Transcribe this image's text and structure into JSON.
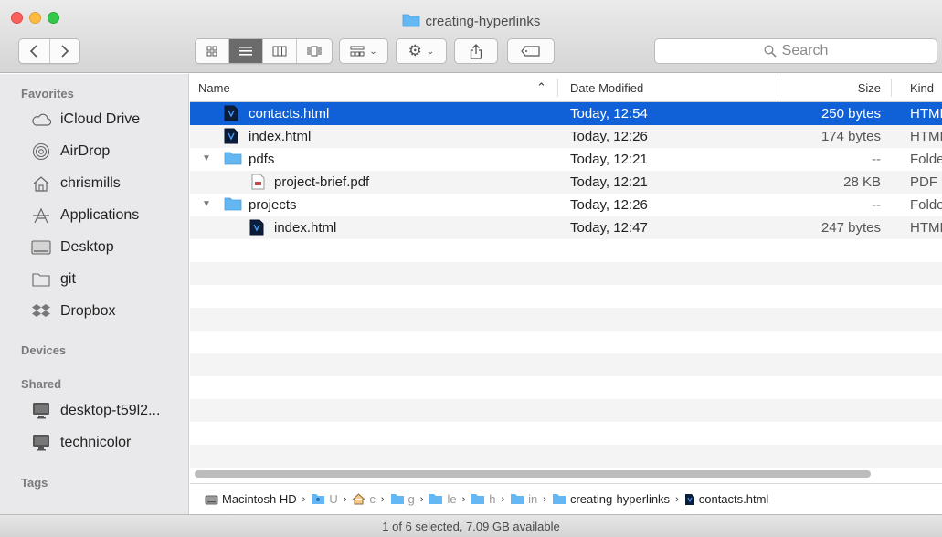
{
  "window": {
    "title": "creating-hyperlinks"
  },
  "toolbar": {
    "view_icon": "▦ ⌄",
    "action_icon": "⚙ ⌄",
    "share_icon": "⬆",
    "tag_icon": "▭"
  },
  "search": {
    "placeholder": "Search",
    "icon": "🔍"
  },
  "sidebar": {
    "favorites_header": "Favorites",
    "favorites": [
      {
        "label": "iCloud Drive",
        "icon": "cloud-icon"
      },
      {
        "label": "AirDrop",
        "icon": "airdrop-icon"
      },
      {
        "label": "chrismills",
        "icon": "home-icon"
      },
      {
        "label": "Applications",
        "icon": "applications-icon"
      },
      {
        "label": "Desktop",
        "icon": "desktop-icon"
      },
      {
        "label": "git",
        "icon": "folder-icon"
      },
      {
        "label": "Dropbox",
        "icon": "dropbox-icon"
      }
    ],
    "devices_header": "Devices",
    "shared_header": "Shared",
    "shared": [
      {
        "label": "desktop-t59l2...",
        "icon": "display-icon"
      },
      {
        "label": "technicolor",
        "icon": "display-icon"
      }
    ],
    "tags_header": "Tags"
  },
  "columns": {
    "name": "Name",
    "date": "Date Modified",
    "size": "Size",
    "kind": "Kind",
    "sort_indicator": "⌃"
  },
  "files": [
    {
      "name": "contacts.html",
      "date": "Today, 12:54",
      "size": "250 bytes",
      "kind": "HTML",
      "type": "html"
    },
    {
      "name": "index.html",
      "date": "Today, 12:26",
      "size": "174 bytes",
      "kind": "HTML",
      "type": "html"
    },
    {
      "name": "pdfs",
      "date": "Today, 12:21",
      "size": "--",
      "kind": "Folder",
      "type": "folder"
    },
    {
      "name": "project-brief.pdf",
      "date": "Today, 12:21",
      "size": "28 KB",
      "kind": "PDF",
      "type": "pdf"
    },
    {
      "name": "projects",
      "date": "Today, 12:26",
      "size": "--",
      "kind": "Folder",
      "type": "folder"
    },
    {
      "name": "index.html",
      "date": "Today, 12:47",
      "size": "247 bytes",
      "kind": "HTML",
      "type": "html"
    }
  ],
  "disclosure": "▼",
  "pathbar": {
    "separator": "›",
    "items": [
      {
        "label": "Macintosh HD",
        "icon": "harddrive-icon"
      },
      {
        "label": "U",
        "icon": "users-folder-icon"
      },
      {
        "label": "c",
        "icon": "home-icon"
      },
      {
        "label": "g",
        "icon": "folder-icon"
      },
      {
        "label": "le",
        "icon": "folder-icon"
      },
      {
        "label": "h",
        "icon": "folder-icon"
      },
      {
        "label": "in",
        "icon": "folder-icon"
      },
      {
        "label": "creating-hyperlinks",
        "icon": "folder-icon"
      },
      {
        "label": "contacts.html",
        "icon": "html-file-icon"
      }
    ]
  },
  "status": {
    "text": "1 of 6 selected, 7.09 GB available"
  },
  "colors": {
    "selection": "#1061d8",
    "folder": "#63b7f2"
  }
}
